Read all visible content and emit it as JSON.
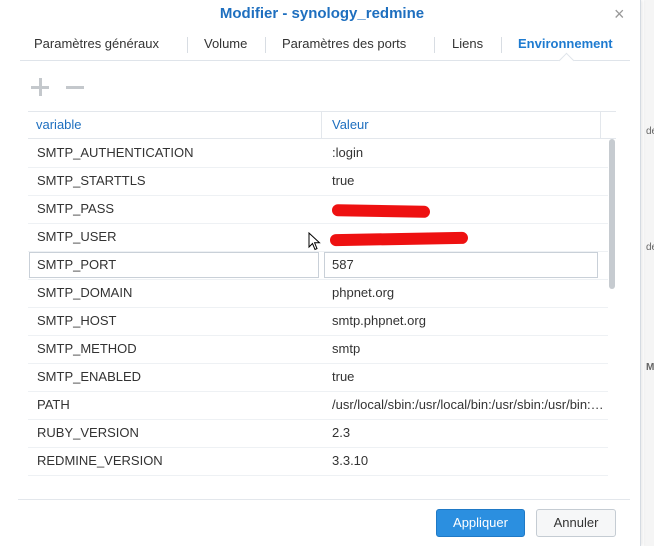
{
  "window": {
    "title": "Modifier - synology_redmine",
    "close_icon": "×"
  },
  "tabs": [
    {
      "label": "Paramètres généraux",
      "active": false
    },
    {
      "label": "Volume",
      "active": false
    },
    {
      "label": "Paramètres des ports",
      "active": false
    },
    {
      "label": "Liens",
      "active": false
    },
    {
      "label": "Environnement",
      "active": true
    }
  ],
  "toolbar": {
    "add_icon": "plus-icon",
    "remove_icon": "minus-icon"
  },
  "grid": {
    "columns": [
      "variable",
      "Valeur"
    ],
    "rows": [
      {
        "variable": "SMTP_AUTHENTICATION",
        "value": ":login"
      },
      {
        "variable": "SMTP_STARTTLS",
        "value": "true"
      },
      {
        "variable": "SMTP_PASS",
        "value": ""
      },
      {
        "variable": "SMTP_USER",
        "value": ""
      },
      {
        "variable": "SMTP_PORT",
        "value": "587"
      },
      {
        "variable": "SMTP_DOMAIN",
        "value": "phpnet.org"
      },
      {
        "variable": "SMTP_HOST",
        "value": "smtp.phpnet.org"
      },
      {
        "variable": "SMTP_METHOD",
        "value": "smtp"
      },
      {
        "variable": "SMTP_ENABLED",
        "value": "true"
      },
      {
        "variable": "PATH",
        "value": "/usr/local/sbin:/usr/local/bin:/usr/sbin:/usr/bin:/sbin:/bin"
      },
      {
        "variable": "RUBY_VERSION",
        "value": "2.3"
      },
      {
        "variable": "REDMINE_VERSION",
        "value": "3.3.10"
      }
    ]
  },
  "footer": {
    "apply_label": "Appliquer",
    "cancel_label": "Annuler"
  },
  "background_fragments": [
    "de",
    "de",
    "M"
  ],
  "colors": {
    "accent": "#1e6fbf",
    "primary_button": "#2b8fe0",
    "redaction": "#ee1111"
  }
}
